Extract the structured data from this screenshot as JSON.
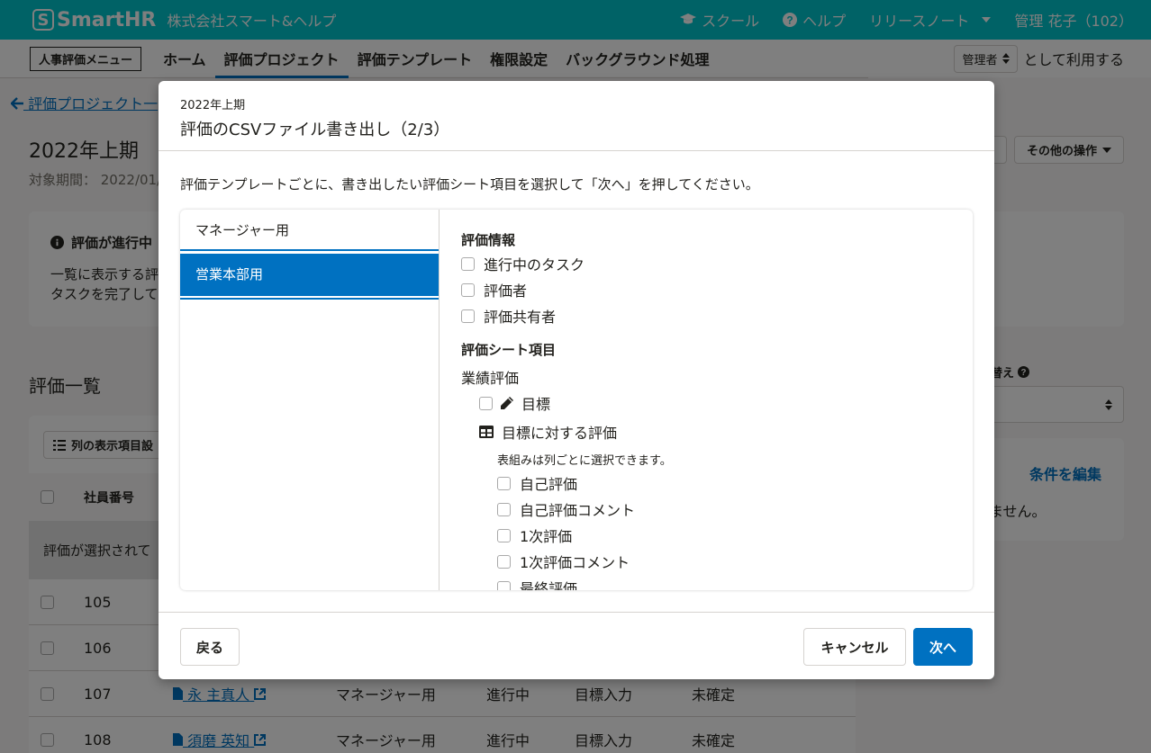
{
  "header": {
    "logo_mark": "S",
    "logo_text": "SmartHR",
    "company": "株式会社スマート&ヘルプ",
    "school": "スクール",
    "help": "ヘルプ",
    "release_notes": "リリースノート",
    "user": "管理 花子（102）"
  },
  "subnav": {
    "menu": "人事評価メニュー",
    "tabs": [
      "ホーム",
      "評価プロジェクト",
      "評価テンプレート",
      "権限設定",
      "バックグラウンド処理"
    ],
    "role_value": "管理者",
    "role_suffix": "として利用する"
  },
  "page": {
    "back_link": "評価プロジェクト一",
    "title": "2022年上期",
    "period": "対象期間： 2022/01/",
    "other_ops": "その他の操作",
    "info_title": "評価が進行中",
    "info_line1": "一覧に表示する評",
    "info_line2": "タスクを完了して",
    "list_title": "評価一覧",
    "column_button": "列の表示項目設",
    "col_employee_no": "社員番号",
    "selection_bar": "評価が選択されて",
    "side_label": "替え",
    "side_edit": "条件を編集",
    "side_text": "ません。",
    "rows": [
      {
        "no": "105",
        "name": "",
        "template": "",
        "status": "",
        "step": "",
        "result": ""
      },
      {
        "no": "106",
        "name": "",
        "template": "",
        "status": "",
        "step": "",
        "result": ""
      },
      {
        "no": "107",
        "name": "永 主真人",
        "template": "マネージャー用",
        "status": "進行中",
        "step": "目標入力",
        "result": "未確定"
      },
      {
        "no": "108",
        "name": "須磨 英知",
        "template": "マネージャー用",
        "status": "進行中",
        "step": "目標入力",
        "result": "未確定"
      }
    ]
  },
  "dialog": {
    "subtitle": "2022年上期",
    "title": "評価のCSVファイル書き出し（2/3）",
    "description": "評価テンプレートごとに、書き出したい評価シート項目を選択して「次へ」を押してください。",
    "templates": [
      "マネージャー用",
      "営業本部用"
    ],
    "section_info": "評価情報",
    "info_items": [
      "進行中のタスク",
      "評価者",
      "評価共有者"
    ],
    "section_sheet": "評価シート項目",
    "group_performance": "業績評価",
    "item_goal": "目標",
    "item_goal_eval": "目標に対する評価",
    "table_note": "表組みは列ごとに選択できます。",
    "columns": [
      "自己評価",
      "自己評価コメント",
      "1次評価",
      "1次評価コメント",
      "最終評価"
    ],
    "back": "戻る",
    "cancel": "キャンセル",
    "next": "次へ"
  }
}
